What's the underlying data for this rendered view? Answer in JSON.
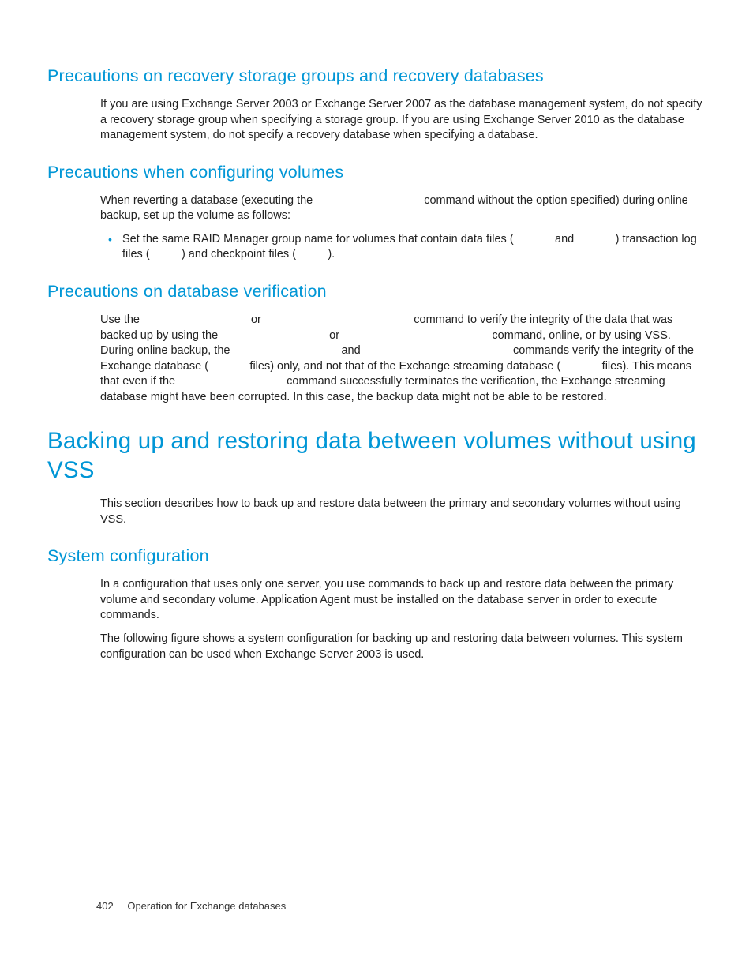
{
  "sections": {
    "s1": {
      "heading": "Precautions on recovery storage groups and recovery databases",
      "p1": "If you are using Exchange Server 2003 or Exchange Server 2007 as the database management system, do not specify a recovery storage group when specifying a storage group. If you are using Exchange Server 2010 as the database management system, do not specify a recovery database when specifying a database."
    },
    "s2": {
      "heading": "Precautions when configuring volumes",
      "p1a": "When reverting a database (executing the ",
      "p1b": " command without the ",
      "p1c": " option specified) during online backup, set up the volume as follows:",
      "li1a": "Set the same RAID Manager group name for volumes that contain data files (",
      "li1b": " and ",
      "li1c": ") transaction log files (",
      "li1d": ") and checkpoint files (",
      "li1e": ")."
    },
    "s3": {
      "heading": "Precautions on database verification",
      "p1a": "Use the ",
      "p1b": " or ",
      "p1c": " command to verify the integrity of the data that was backed up by using the ",
      "p1d": " or ",
      "p1e": " command, online, or by using VSS. During online backup, the ",
      "p1f": " and ",
      "p1g": " commands verify the integrity of the Exchange database (",
      "p1h": " files) only, and not that of the Exchange streaming database (",
      "p1i": " files). This means that even if the ",
      "p1j": " command successfully terminates the verification, the Exchange streaming database might have been corrupted. In this case, the backup data might not be able to be restored."
    },
    "s4": {
      "heading": "Backing up and restoring data between volumes without using VSS",
      "p1": "This section describes how to back up and restore data between the primary and secondary volumes without using VSS."
    },
    "s5": {
      "heading": "System configuration",
      "p1": "In a configuration that uses only one server, you use commands to back up and restore data between the primary volume and secondary volume. Application Agent must be installed on the database server in order to execute commands.",
      "p2": "The following figure shows a system configuration for backing up and restoring data between volumes. This system configuration can be used when Exchange Server 2003 is used."
    }
  },
  "footer": {
    "page": "402",
    "title": "Operation for Exchange databases"
  },
  "gaps": {
    "cmd_long": "                                 ",
    "cmd_med": "                                              ",
    "short": "            ",
    "tiny": "          "
  }
}
